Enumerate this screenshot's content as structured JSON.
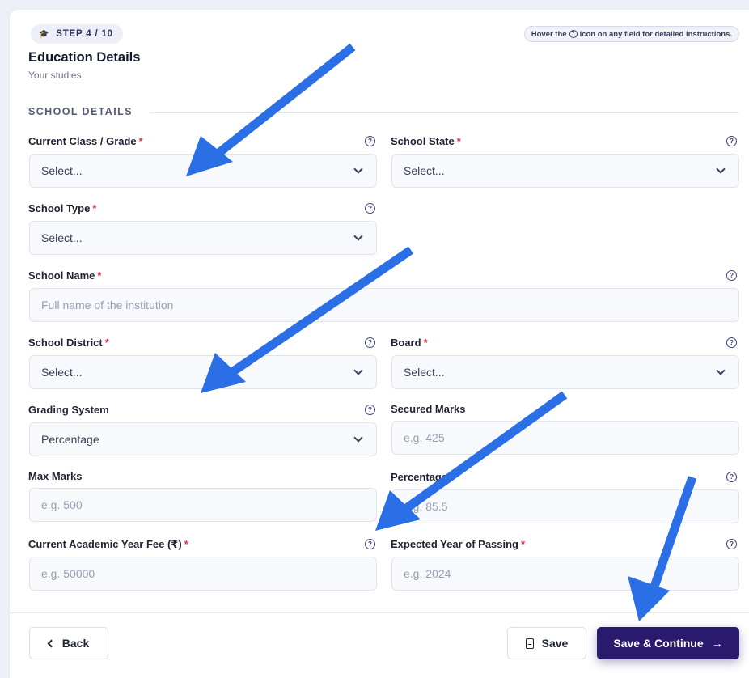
{
  "header": {
    "step_badge": "STEP 4 / 10",
    "hint_before": "Hover the",
    "hint_after": "icon on any field for detailed instructions.",
    "title": "Education Details",
    "subtitle": "Your studies"
  },
  "section": {
    "title": "SCHOOL DETAILS"
  },
  "fields": {
    "current_class": {
      "label": "Current Class / Grade",
      "value": "Select..."
    },
    "school_state": {
      "label": "School State",
      "value": "Select..."
    },
    "school_type": {
      "label": "School Type",
      "value": "Select..."
    },
    "school_name": {
      "label": "School Name",
      "placeholder": "Full name of the institution"
    },
    "school_district": {
      "label": "School District",
      "value": "Select..."
    },
    "board": {
      "label": "Board",
      "value": "Select..."
    },
    "grading_system": {
      "label": "Grading System",
      "value": "Percentage"
    },
    "secured_marks": {
      "label": "Secured Marks",
      "placeholder": "e.g. 425"
    },
    "max_marks": {
      "label": "Max Marks",
      "placeholder": "e.g. 500"
    },
    "percentage": {
      "label": "Percentage",
      "placeholder": "e.g. 85.5"
    },
    "academic_fee": {
      "label": "Current Academic Year Fee (₹)",
      "placeholder": "e.g. 50000"
    },
    "year_of_passing": {
      "label": "Expected Year of Passing",
      "placeholder": "e.g. 2024"
    }
  },
  "required_mark": "*",
  "help_glyph": "?",
  "buttons": {
    "back": "Back",
    "save": "Save",
    "save_continue": "Save & Continue",
    "arrow": "→"
  },
  "colors": {
    "primary": "#2a1a6e",
    "annotation_arrow": "#2b6fe6",
    "required": "#e0304a"
  },
  "icons": [
    "graduation-cap-icon",
    "help-circle-icon",
    "chevron-down-icon",
    "chevron-left-icon",
    "document-icon",
    "arrow-right-icon"
  ]
}
